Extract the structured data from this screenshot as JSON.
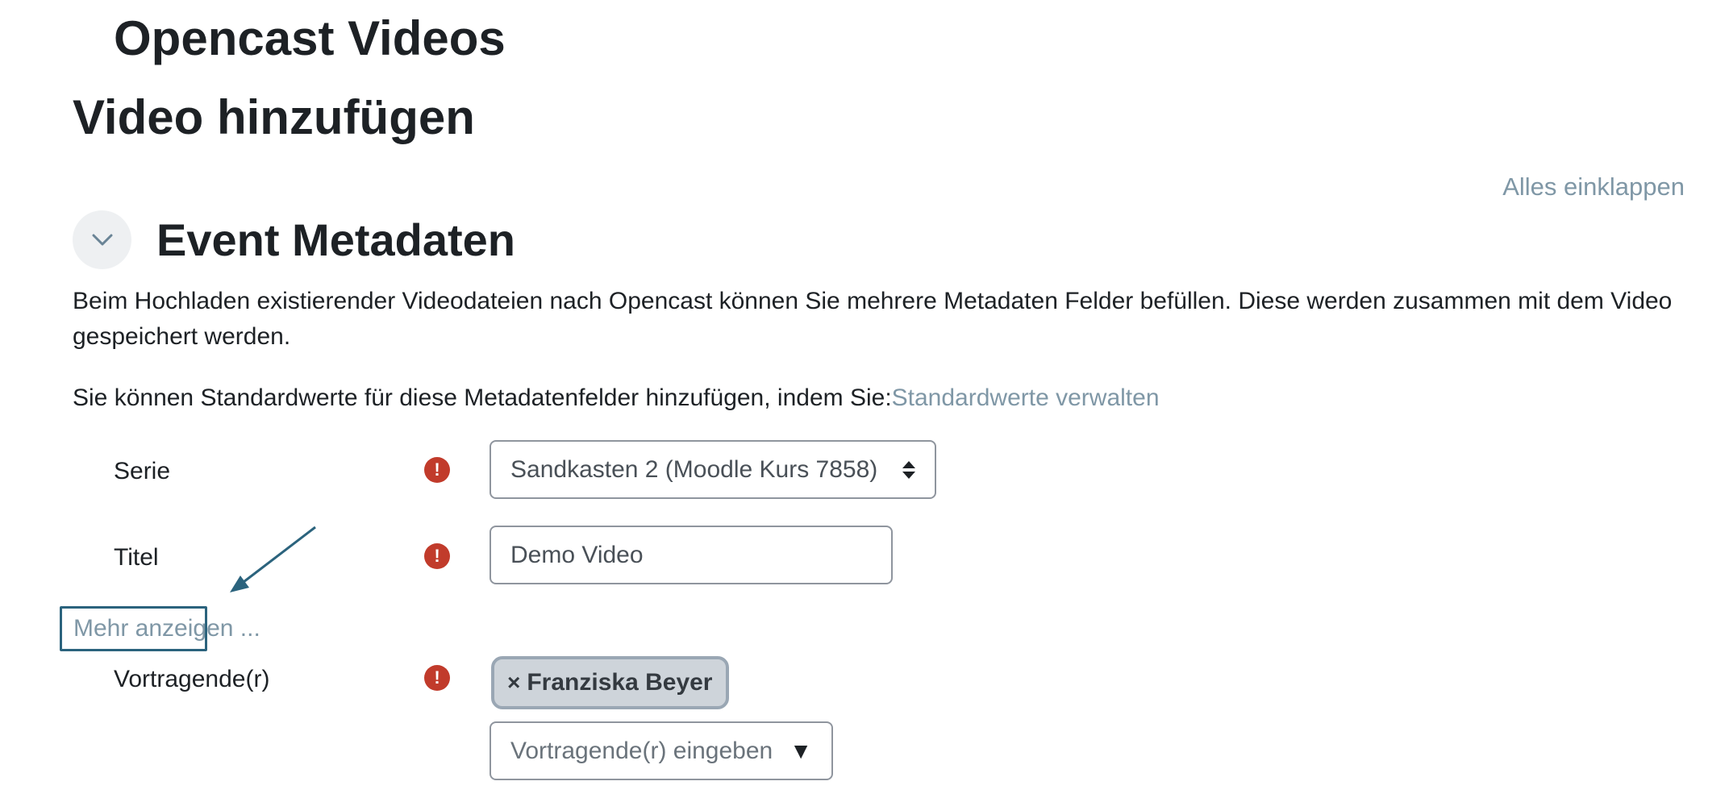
{
  "page": {
    "heading": "Opencast Videos",
    "subheading": "Video hinzufügen",
    "collapse_all": "Alles einklappen"
  },
  "section": {
    "title": "Event Metadaten",
    "toggle_icon": "chevron-down-icon",
    "intro": "Beim Hochladen existierender Videodateien nach Opencast können Sie mehrere Metadaten Felder befüllen. Diese werden zusammen mit dem Video gespeichert werden.",
    "defaults_text": "Sie können Standardwerte für diese Metadatenfelder hinzufügen, indem Sie:",
    "defaults_link": "Standardwerte verwalten"
  },
  "fields": {
    "serie": {
      "label": "Serie",
      "value": "Sandkasten 2 (Moodle Kurs 7858)"
    },
    "titel": {
      "label": "Titel",
      "value": "Demo Video"
    },
    "more_link": "Mehr anzeigen ...",
    "vortragende": {
      "label": "Vortragende(r)",
      "tag_remove": "×",
      "tag": "Franziska Beyer",
      "placeholder": "Vortragende(r) eingeben",
      "dropdown_arrow": "▼"
    },
    "required_icon": "!"
  },
  "colors": {
    "link": "#7f97a6",
    "required": "#c13b2b",
    "annotation": "#2b637d",
    "tag_bg": "#ced4da"
  }
}
